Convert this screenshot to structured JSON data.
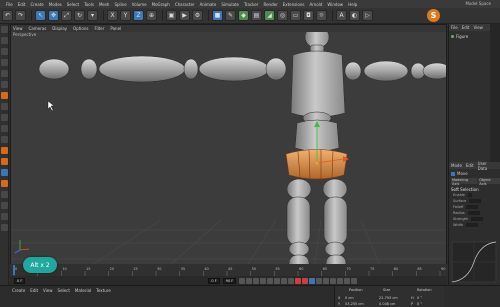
{
  "menubar": {
    "items": [
      "File",
      "Edit",
      "Create",
      "Modes",
      "Select",
      "Tools",
      "Mesh",
      "Spline",
      "Volume",
      "MoGraph",
      "Character",
      "Animate",
      "Simulate",
      "Tracker",
      "Render",
      "Extensions",
      "Arnold",
      "Window",
      "Help"
    ],
    "layout_label": "Model Space"
  },
  "viewport": {
    "menu": [
      "View",
      "Cameras",
      "Display",
      "Options",
      "Filter",
      "Panel"
    ],
    "label": "Perspective",
    "grid_spacing": "Grid Spacing : 100 cm"
  },
  "badge": {
    "text": "Alt x 2",
    "color": "#1fa8a0"
  },
  "timeline": {
    "ticks": [
      "0",
      "5",
      "10",
      "15",
      "20",
      "25",
      "30",
      "35",
      "40",
      "45",
      "50",
      "55",
      "60",
      "65",
      "70",
      "75",
      "80",
      "85",
      "90"
    ],
    "current_frame": "0 F",
    "start": "0 F",
    "end": "90 F",
    "end2": "90 F"
  },
  "material_menu": [
    "Create",
    "Edit",
    "View",
    "Select",
    "Material",
    "Texture"
  ],
  "coordinates": {
    "headers": [
      "Position",
      "Size",
      "Rotation"
    ],
    "rows": [
      {
        "axis": "X",
        "pos": "0 cm",
        "size": "22.793 cm",
        "rot_axis": "H",
        "rot": "0 °"
      },
      {
        "axis": "Y",
        "pos": "53.255 cm",
        "size": "0.048 cm",
        "rot_axis": "P",
        "rot": "0 °"
      }
    ]
  },
  "object_panel": {
    "tabs": [
      "File",
      "Edit",
      "View"
    ],
    "object_name": "Figure"
  },
  "attr_panel": {
    "tabs": [
      "Mode",
      "Edit",
      "User Data"
    ],
    "tool": "Move",
    "subtabs": [
      "Modeling Axis",
      "Object Axis"
    ],
    "section": "Soft Selection",
    "fields": [
      "Enable",
      "Surface",
      "Falloff",
      "Radius",
      "Strength",
      "Width"
    ]
  },
  "colors": {
    "accent": "#e07820",
    "selection": "#d8914a",
    "badge": "#1fa8a0"
  }
}
